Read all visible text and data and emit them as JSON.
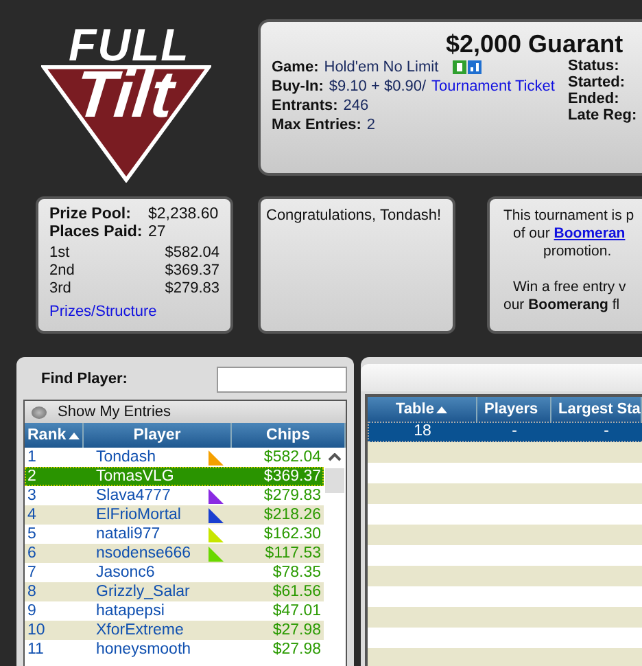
{
  "logo": {
    "top": "FULL",
    "main": "Tilt"
  },
  "header": {
    "title": "$2,000 Guarant",
    "left": [
      {
        "label": "Game:",
        "value": "Hold'em No Limit",
        "icons": true
      },
      {
        "label": "Buy-In:",
        "value": "$9.10 + $0.90/",
        "link": "Tournament Ticket"
      },
      {
        "label": "Entrants:",
        "value": "246"
      },
      {
        "label": "Max Entries:",
        "value": "2"
      }
    ],
    "right": [
      "Status:",
      "Started:",
      "Ended:",
      "Late Reg:"
    ]
  },
  "prize": {
    "pool_label": "Prize Pool:",
    "pool": "$2,238.60",
    "paid_label": "Places Paid:",
    "paid": "27",
    "places": [
      {
        "place": "1st",
        "amount": "$582.04"
      },
      {
        "place": "2nd",
        "amount": "$369.37"
      },
      {
        "place": "3rd",
        "amount": "$279.83"
      }
    ],
    "link": "Prizes/Structure"
  },
  "message": "Congratulations, Tondash!",
  "promo": {
    "line1": "This tournament is p",
    "line2_prefix": "of our ",
    "line2_link": "Boomeran",
    "line3": "promotion.",
    "line4": "Win a free entry v",
    "line5": "our **Boomerang** fl"
  },
  "find_player": {
    "label": "Find Player:"
  },
  "show_entries": {
    "label": "Show My Entries",
    "checked": false
  },
  "players": {
    "columns": [
      "Rank",
      "Player",
      "Chips"
    ],
    "rows": [
      {
        "rank": "1",
        "player": "Tondash",
        "chips": "$582.04",
        "color": "#f5a000",
        "selected": false
      },
      {
        "rank": "2",
        "player": "TomasVLG",
        "chips": "$369.37",
        "selected": true
      },
      {
        "rank": "3",
        "player": "Slava4777",
        "chips": "$279.83",
        "color": "#8a2be2",
        "selected": false
      },
      {
        "rank": "4",
        "player": "ElFrioMortal",
        "chips": "$218.26",
        "color": "#1a3fd0",
        "selected": false
      },
      {
        "rank": "5",
        "player": "natali977",
        "chips": "$162.30",
        "color": "#c8e600",
        "selected": false
      },
      {
        "rank": "6",
        "player": "nsodense666",
        "chips": "$117.53",
        "color": "#6ad800",
        "selected": false
      },
      {
        "rank": "7",
        "player": "Jasonc6",
        "chips": "$78.35",
        "selected": false
      },
      {
        "rank": "8",
        "player": "Grizzly_Salar",
        "chips": "$61.56",
        "selected": false
      },
      {
        "rank": "9",
        "player": "hatapepsi",
        "chips": "$47.01",
        "selected": false
      },
      {
        "rank": "10",
        "player": "XforExtreme",
        "chips": "$27.98",
        "selected": false
      },
      {
        "rank": "11",
        "player": "honeysmooth",
        "chips": "$27.98",
        "selected": false
      }
    ]
  },
  "tables": {
    "columns": [
      "Table",
      "Players",
      "Largest Sta"
    ],
    "rows": [
      {
        "table": "18",
        "players": "-",
        "largest": "-",
        "selected": true
      }
    ]
  }
}
